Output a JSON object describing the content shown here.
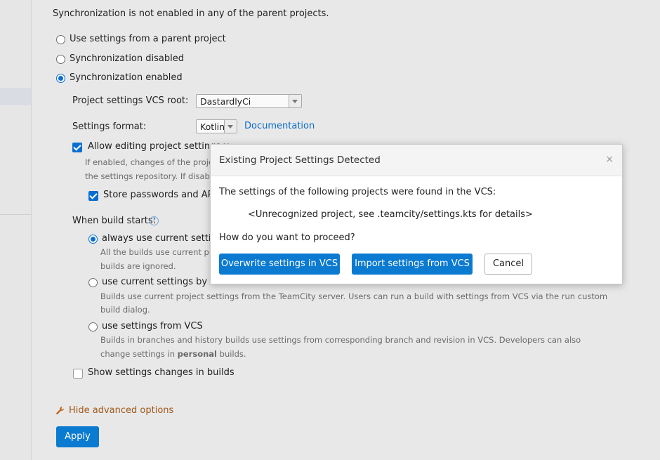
{
  "sync": {
    "notice": "Synchronization is not enabled in any of the parent projects.",
    "options": [
      {
        "label": "Use settings from a parent project",
        "selected": false
      },
      {
        "label": "Synchronization disabled",
        "selected": false
      },
      {
        "label": "Synchronization enabled",
        "selected": true
      }
    ],
    "vcs_root_label": "Project settings VCS root:",
    "vcs_root_value": "DastardlyCi",
    "format_label": "Settings format:",
    "format_value": "Kotlin",
    "documentation_link": "Documentation",
    "allow_editing_label": "Allow editing project settings v",
    "allow_editing_note_1": "If enabled, changes of the project",
    "allow_editing_note_2": "the settings repository. If disabled,",
    "store_passwords_label": "Store passwords and API t",
    "when_build_label": "When build starts:",
    "build_options": [
      {
        "label": "always use current settings",
        "selected": true,
        "note_1": "All the builds use current proje",
        "note_2": "builds are ignored."
      },
      {
        "label": "use current settings by default",
        "selected": false,
        "note_1": "Builds use current project settings from the TeamCity server. Users can run a build with settings from VCS via the run custom",
        "note_2": "build dialog."
      },
      {
        "label": "use settings from VCS",
        "selected": false,
        "note_1": "Builds in branches and history builds use settings from corresponding branch and revision in VCS. Developers can also",
        "note_2_pre": "change settings in ",
        "note_2_bold": "personal",
        "note_2_post": " builds."
      }
    ],
    "show_changes_label": "Show settings changes in builds",
    "hide_advanced_label": "Hide advanced options",
    "apply_label": "Apply"
  },
  "dialog": {
    "title": "Existing Project Settings Detected",
    "close_glyph": "×",
    "message": "The settings of the following projects were found in the VCS:",
    "item": "<Unrecognized project, see .teamcity/settings.kts for details>",
    "question": "How do you want to proceed?",
    "overwrite_label": "Overwrite settings in VCS",
    "import_label": "Import settings from VCS",
    "cancel_label": "Cancel"
  },
  "icons": {
    "wrench": "wrench-icon",
    "help": "question-circle-icon",
    "help_glyph": "?"
  },
  "colors": {
    "accent": "#0b7ad1",
    "link": "#0b6ccb",
    "advanced_link": "#a0581a"
  }
}
